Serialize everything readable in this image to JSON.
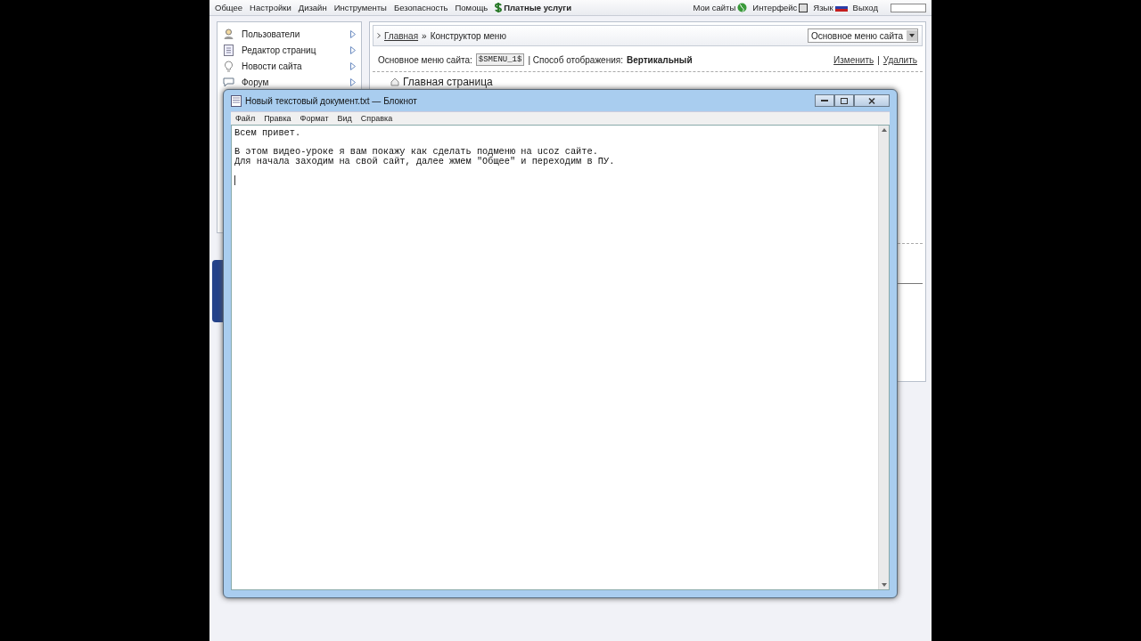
{
  "top_nav": {
    "items": [
      {
        "label": "Общее",
        "kind": "plain"
      },
      {
        "label": "Настройки",
        "kind": "plain"
      },
      {
        "label": "Дизайн",
        "kind": "plain"
      },
      {
        "label": "Инструменты",
        "kind": "plain"
      },
      {
        "label": "Безопасность",
        "kind": "plain"
      },
      {
        "label": "Помощь",
        "kind": "plain"
      },
      {
        "label": "Платные услуги",
        "kind": "paid"
      }
    ],
    "right_items": [
      {
        "label": "Мои сайты",
        "kind": "globe"
      },
      {
        "label": "Интерфейс",
        "kind": "square"
      },
      {
        "label": "Язык",
        "kind": "flag"
      },
      {
        "label": "Выход",
        "kind": "plain"
      }
    ]
  },
  "sidebar": {
    "items": [
      {
        "label": "Пользователи",
        "kind": "user"
      },
      {
        "label": "Редактор страниц",
        "kind": "page"
      },
      {
        "label": "Новости сайта",
        "kind": "bulb"
      },
      {
        "label": "Форум",
        "kind": "chat"
      }
    ]
  },
  "breadcrumb": {
    "link": "Главная",
    "separator": "»",
    "current": "Конструктор меню"
  },
  "menu_select": {
    "value": "Основное меню сайта"
  },
  "menu_info": {
    "label": "Основное меню сайта:",
    "code": "$SMENU_1$",
    "mode_label": "| Способ отображения:",
    "mode_value": "Вертикальный",
    "links": [
      "Изменить",
      "|",
      "Удалить"
    ]
  },
  "tree": {
    "items": [
      {
        "label": "Главная страница"
      }
    ]
  },
  "notepad": {
    "title": "Новый текстовый документ.txt — Блокнот",
    "menu": [
      "Файл",
      "Правка",
      "Формат",
      "Вид",
      "Справка"
    ],
    "paragraphs": [
      [
        "Всем привет."
      ],
      [
        "В этом видео-уроке я вам покажу как сделать подменю на ucoz сайте.",
        "Для начала заходим на свой сайт, далее жмем \"Общее\" и переходим в ПУ."
      ]
    ]
  }
}
